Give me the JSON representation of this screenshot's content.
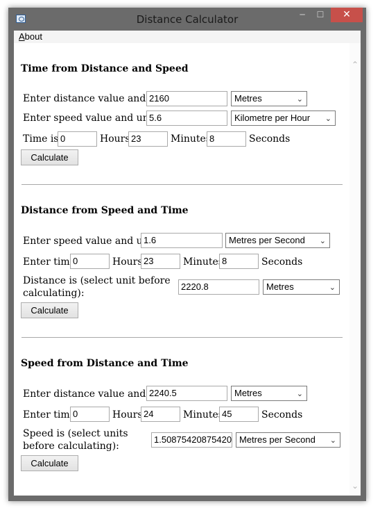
{
  "window": {
    "title": "Distance Calculator"
  },
  "menu": {
    "about": "About"
  },
  "time_section": {
    "heading": "Time from Distance and Speed",
    "distance_label": "Enter distance value and unit:",
    "distance_value": "2160",
    "distance_unit": "Metres",
    "speed_label": "Enter speed value and units:",
    "speed_value": "5.6",
    "speed_unit": "Kilometre per Hour",
    "time_is_label": "Time is:",
    "hours_value": "0",
    "hours_label": "Hours",
    "minutes_value": "23",
    "minutes_label": "Minutes",
    "seconds_value": "8",
    "seconds_label": "Seconds",
    "calculate": "Calculate"
  },
  "distance_section": {
    "heading": "Distance from Speed and Time",
    "speed_label": "Enter speed value and units:",
    "speed_value": "1.6",
    "speed_unit": "Metres per Second",
    "time_label": "Enter time:",
    "hours_value": "0",
    "hours_label": "Hours",
    "minutes_value": "23",
    "minutes_label": "Minutes",
    "seconds_value": "8",
    "seconds_label": "Seconds",
    "result_label": "Distance is (select unit before calculating):",
    "result_value": "2220.8",
    "result_unit": "Metres",
    "calculate": "Calculate"
  },
  "speed_section": {
    "heading": "Speed from Distance and Time",
    "distance_label": "Enter distance value and unit:",
    "distance_value": "2240.5",
    "distance_unit": "Metres",
    "time_label": "Enter time:",
    "hours_value": "0",
    "hours_label": "Hours",
    "minutes_value": "24",
    "minutes_label": "Minutes",
    "seconds_value": "45",
    "seconds_label": "Seconds",
    "result_label": "Speed is (select units before calculating):",
    "result_value": "1.50875420875420",
    "result_unit": "Metres per Second",
    "calculate": "Calculate"
  },
  "colors": {
    "close_button": "#c7504a",
    "window_frame": "#6b6b6b"
  }
}
